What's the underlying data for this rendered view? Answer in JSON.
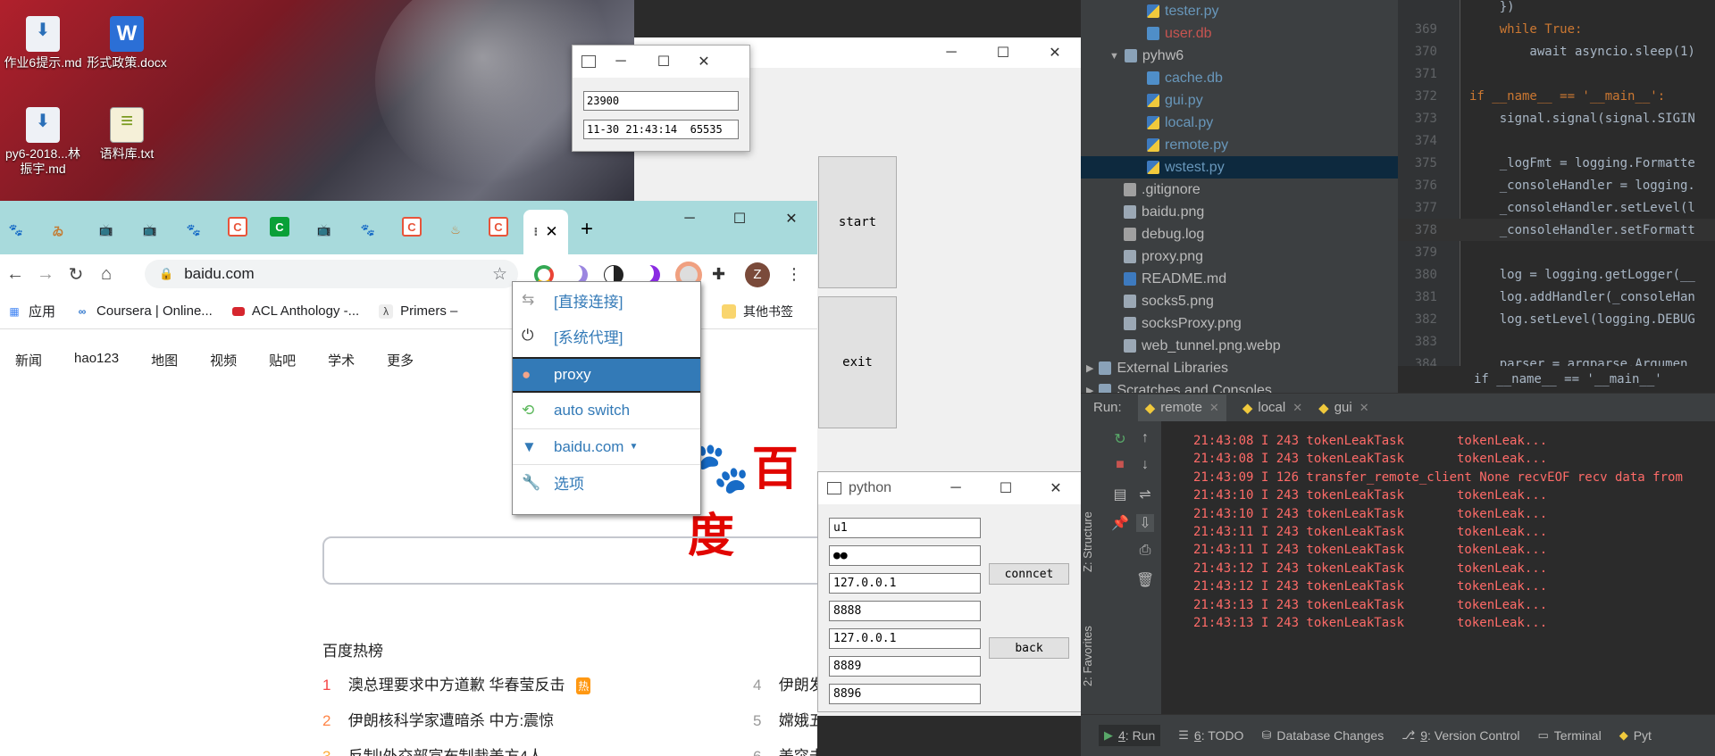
{
  "desktop": {
    "icons": [
      {
        "label": "作业6提示.md",
        "icon": "markdown-file-icon"
      },
      {
        "label": "形式政策.docx",
        "icon": "word-doc-icon"
      },
      {
        "label": "py6-2018...林振宇.md",
        "icon": "markdown-file-icon"
      },
      {
        "label": "语料库.txt",
        "icon": "text-file-icon"
      }
    ]
  },
  "tk_small": {
    "entry1": "23900",
    "entry2": "11-30 21:43:14  65535"
  },
  "blank_window": {
    "start_label": "start",
    "exit_label": "exit"
  },
  "chrome": {
    "tabs": [
      {
        "icon": "baidu-paw-icon"
      },
      {
        "icon": "ant-icon"
      },
      {
        "icon": "bilibili-icon"
      },
      {
        "icon": "bilibili-icon"
      },
      {
        "icon": "baidu-paw-icon"
      },
      {
        "icon": "csdn-c-icon"
      },
      {
        "icon": "green-c-icon"
      },
      {
        "icon": "bilibili-icon"
      },
      {
        "icon": "baidu-paw-icon"
      },
      {
        "icon": "csdn-c-icon"
      },
      {
        "icon": "ant-icon"
      },
      {
        "icon": "csdn-c-icon"
      }
    ],
    "url": "baidu.com",
    "profile_initial": "Z",
    "bookmarks": [
      {
        "label": "应用"
      },
      {
        "label": "Coursera | Online..."
      },
      {
        "label": "ACL Anthology -..."
      },
      {
        "label": "Primers – "
      },
      {
        "label": "其他书签"
      }
    ],
    "baidu_nav": [
      "新闻",
      "hao123",
      "地图",
      "视频",
      "贴吧",
      "学术",
      "更多"
    ],
    "baidu_logo": "百度",
    "hot_title": "百度热榜",
    "hot_items": [
      {
        "rank": "1",
        "text": "澳总理要求中方道歉 华春莹反击",
        "badge": "热"
      },
      {
        "rank": "2",
        "text": "伊朗核科学家遭暗杀 中方:震惊"
      },
      {
        "rank": "3",
        "text": "反制!外交部宣布制裁美方4人"
      },
      {
        "rank": "4",
        "text": "伊朗发"
      },
      {
        "rank": "5",
        "text": "嫦娥五"
      },
      {
        "rank": "6",
        "text": "美突击"
      }
    ]
  },
  "proxy_menu": {
    "items": [
      {
        "label": "[直接连接]"
      },
      {
        "label": "[系统代理]"
      },
      {
        "label": "proxy"
      },
      {
        "label": "auto switch"
      },
      {
        "label": "baidu.com"
      },
      {
        "label": "选项"
      }
    ]
  },
  "python_window": {
    "title": "python",
    "user": "u1",
    "password": "●●",
    "local_host": "127.0.0.1",
    "local_port": "8888",
    "remote_host": "127.0.0.1",
    "remote_port": "8889",
    "extra_port": "8896",
    "connect_label": "conncet",
    "back_label": "back"
  },
  "ide": {
    "tree": [
      {
        "label": "tester.py",
        "type": "py",
        "indent": 2,
        "color": "blue"
      },
      {
        "label": "user.db",
        "type": "db",
        "indent": 2,
        "color": "red"
      },
      {
        "label": "pyhw6",
        "type": "folder",
        "indent": 1,
        "color": "normal",
        "arrow": "▼"
      },
      {
        "label": "cache.db",
        "type": "db",
        "indent": 2,
        "color": "blue"
      },
      {
        "label": "gui.py",
        "type": "py",
        "indent": 2,
        "color": "blue"
      },
      {
        "label": "local.py",
        "type": "py",
        "indent": 2,
        "color": "blue"
      },
      {
        "label": "remote.py",
        "type": "py",
        "indent": 2,
        "color": "blue"
      },
      {
        "label": "wstest.py",
        "type": "py",
        "indent": 2,
        "color": "blue",
        "selected": true
      },
      {
        "label": ".gitignore",
        "type": "file",
        "indent": 1,
        "color": "normal"
      },
      {
        "label": "baidu.png",
        "type": "img",
        "indent": 1,
        "color": "normal"
      },
      {
        "label": "debug.log",
        "type": "file",
        "indent": 1,
        "color": "normal"
      },
      {
        "label": "proxy.png",
        "type": "img",
        "indent": 1,
        "color": "normal"
      },
      {
        "label": "README.md",
        "type": "md",
        "indent": 1,
        "color": "normal"
      },
      {
        "label": "socks5.png",
        "type": "img",
        "indent": 1,
        "color": "normal"
      },
      {
        "label": "socksProxy.png",
        "type": "img",
        "indent": 1,
        "color": "normal"
      },
      {
        "label": "web_tunnel.png.webp",
        "type": "img",
        "indent": 1,
        "color": "normal"
      },
      {
        "label": "External Libraries",
        "type": "lib",
        "indent": 0,
        "color": "normal",
        "arrow": "▶"
      },
      {
        "label": "Scratches and Consoles",
        "type": "lib",
        "indent": 0,
        "color": "normal",
        "arrow": "▶"
      }
    ],
    "code": [
      {
        "ln": "",
        "text": "    })"
      },
      {
        "ln": "369",
        "text": "    while True:"
      },
      {
        "ln": "370",
        "text": "        await asyncio.sleep(1)"
      },
      {
        "ln": "371",
        "text": ""
      },
      {
        "ln": "372",
        "text": "if __name__ == '__main__':"
      },
      {
        "ln": "373",
        "text": "    signal.signal(signal.SIGIN"
      },
      {
        "ln": "374",
        "text": ""
      },
      {
        "ln": "375",
        "text": "    _logFmt = logging.Formatte"
      },
      {
        "ln": "376",
        "text": "    _consoleHandler = logging."
      },
      {
        "ln": "377",
        "text": "    _consoleHandler.setLevel(l"
      },
      {
        "ln": "378",
        "text": "    _consoleHandler.setFormatt"
      },
      {
        "ln": "379",
        "text": ""
      },
      {
        "ln": "380",
        "text": "    log = logging.getLogger(__"
      },
      {
        "ln": "381",
        "text": "    log.addHandler(_consoleHan"
      },
      {
        "ln": "382",
        "text": "    log.setLevel(logging.DEBUG"
      },
      {
        "ln": "383",
        "text": ""
      },
      {
        "ln": "384",
        "text": "    parser = argparse.Argumen"
      }
    ],
    "breadcrumb": "if __name__ == '__main__'",
    "run_label": "Run:",
    "run_tabs": [
      {
        "label": "remote"
      },
      {
        "label": "local"
      },
      {
        "label": "gui"
      }
    ],
    "side_labels": {
      "structure": "Z: Structure",
      "favorites": "2: Favorites"
    },
    "console": [
      "21:43:08 I 243 tokenLeakTask       tokenLeak...",
      "21:43:08 I 243 tokenLeakTask       tokenLeak...",
      "21:43:09 I 126 transfer_remote_client None recvEOF recv data from",
      "21:43:10 I 243 tokenLeakTask       tokenLeak...",
      "21:43:10 I 243 tokenLeakTask       tokenLeak...",
      "21:43:11 I 243 tokenLeakTask       tokenLeak...",
      "21:43:11 I 243 tokenLeakTask       tokenLeak...",
      "21:43:12 I 243 tokenLeakTask       tokenLeak...",
      "21:43:12 I 243 tokenLeakTask       tokenLeak...",
      "21:43:13 I 243 tokenLeakTask       tokenLeak...",
      "21:43:13 I 243 tokenLeakTask       tokenLeak..."
    ],
    "bottom_tabs": [
      {
        "num": "4",
        "label": ": Run"
      },
      {
        "num": "6",
        "label": ": TODO"
      },
      {
        "num": "",
        "label": "Database Changes"
      },
      {
        "num": "9",
        "label": ": Version Control"
      },
      {
        "num": "",
        "label": "Terminal"
      },
      {
        "num": "",
        "label": "Pyt"
      }
    ]
  }
}
